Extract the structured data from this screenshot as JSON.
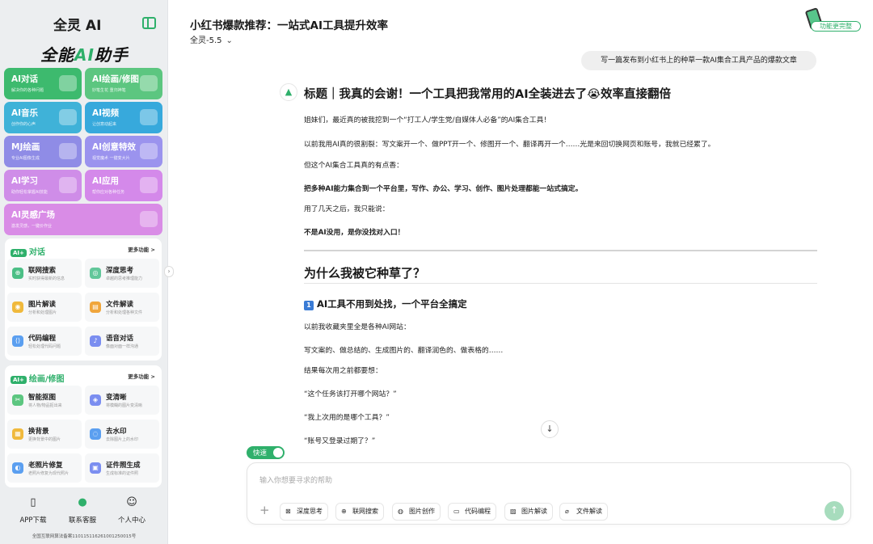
{
  "sidebar": {
    "brand": "全灵 AI",
    "slogan_pre": "全能",
    "slogan_ai": "AI",
    "slogan_post": "助手",
    "cards": [
      {
        "title": "AI对话",
        "sub": "解决你的各种问题",
        "color": "#3dba6e"
      },
      {
        "title": "AI绘画/修图",
        "sub": "妙笔生花 重归神笔",
        "color": "#5cc680"
      },
      {
        "title": "AI音乐",
        "sub": "创作你的心声",
        "color": "#3fb2d8"
      },
      {
        "title": "AI视频",
        "sub": "让创意动起来",
        "color": "#37a9dc"
      },
      {
        "title": "MJ绘画",
        "sub": "专业AI图像生成",
        "color": "#8f8ce6"
      },
      {
        "title": "AI创意特效",
        "sub": "视觉魔术 一键变大片",
        "color": "#9b93ee"
      },
      {
        "title": "AI学习",
        "sub": "助你轻松掌握AI技能",
        "color": "#cf8de8"
      },
      {
        "title": "AI应用",
        "sub": "帮你应对各种任务",
        "color": "#d489ea"
      },
      {
        "title": "AI灵感广场",
        "sub": "激发灵感，一键价作业",
        "color": "#d98ce6"
      }
    ],
    "chat_panel": {
      "tag": "AI+",
      "heading": "对话",
      "more": "更多功能 >",
      "items": [
        {
          "title": "联网搜索",
          "sub": "实时获得最新的信息",
          "color": "#4cbf86",
          "glyph": "⊕"
        },
        {
          "title": "深度思考",
          "sub": "卓越的思考推理能力",
          "color": "#62c79a",
          "glyph": "◎"
        },
        {
          "title": "图片解读",
          "sub": "分析和处理图片",
          "color": "#f0b93c",
          "glyph": "◉"
        },
        {
          "title": "文件解读",
          "sub": "分析和处理各种文件",
          "color": "#f0a63c",
          "glyph": "▤"
        },
        {
          "title": "代码编程",
          "sub": "轻松处理代码问题",
          "color": "#5b9ff0",
          "glyph": "⟨⟩"
        },
        {
          "title": "语音对话",
          "sub": "像面对面一样沟通",
          "color": "#7b8ef0",
          "glyph": "♪"
        }
      ]
    },
    "draw_panel": {
      "tag": "AI+",
      "heading": "绘画/修图",
      "more": "更多功能 >",
      "items": [
        {
          "title": "智能抠图",
          "sub": "将人物/物品抠出来",
          "color": "#5cc680",
          "glyph": "✂"
        },
        {
          "title": "变清晰",
          "sub": "将模糊的图片变清晰",
          "color": "#7b8ef0",
          "glyph": "◈"
        },
        {
          "title": "换背景",
          "sub": "更换背景中的图片",
          "color": "#f0b93c",
          "glyph": "▦"
        },
        {
          "title": "去水印",
          "sub": "去除图片上的水印",
          "color": "#5b9ff0",
          "glyph": "◌"
        },
        {
          "title": "老照片修复",
          "sub": "老照片修复为现代照片",
          "color": "#5b9ff0",
          "glyph": "◐"
        },
        {
          "title": "证件照生成",
          "sub": "生成标准的证件照",
          "color": "#7b8ef0",
          "glyph": "▣"
        }
      ]
    },
    "footer": [
      {
        "label": "APP下载",
        "icon": "phone-icon",
        "glyph": "▯"
      },
      {
        "label": "联系客服",
        "icon": "support-avatar-icon",
        "glyph": "●"
      },
      {
        "label": "个人中心",
        "icon": "user-icon",
        "glyph": "☺"
      }
    ],
    "icp": "全国互联网算法备案110115116261001250015号"
  },
  "header": {
    "title": "小红书爆款推荐：一站式AI工具提升效率",
    "model": "全灵-5.5",
    "upgrade": "功能更完整"
  },
  "chat": {
    "user_message": "写一篇发布到小红书上的种草一款AI集合工具产品的爆款文章",
    "h1": "标题｜我真的会谢！一个工具把我常用的AI全装进去了😭效率直接翻倍",
    "p1": "姐妹们，最近真的被我挖到一个“打工人/学生党/自媒体人必备”的AI集合工具！",
    "p2": "以前我用AI真的很割裂：写文案开一个、做PPT开一个、修图开一个、翻译再开一个……光是来回切换网页和账号，我就已经累了。",
    "p3": "但这个AI集合工具真的有点香：",
    "p4": "把多种AI能力集合到一个平台里，写作、办公、学习、创作、图片处理都能一站式搞定。",
    "p5": "用了几天之后，我只能说：",
    "p6": "不是AI没用，是你没找对入口！",
    "h2": "为什么我被它种草了？",
    "h3_num": "1",
    "h3": "AI工具不用到处找，一个平台全搞定",
    "p7": "以前我收藏夹里全是各种AI网站：",
    "p8": "写文案的、做总结的、生成图片的、翻译润色的、做表格的……",
    "p9": "结果每次用之前都要想：",
    "p10": "“这个任务该打开哪个网站？”",
    "p11": "“我上次用的是哪个工具？”",
    "p12": "“账号又登录过期了？”"
  },
  "composer": {
    "quick_label": "快速",
    "placeholder": "输入你想要寻求的帮助",
    "tools": [
      {
        "label": "深度思考",
        "icon": "deep-think-icon",
        "glyph": "⊠"
      },
      {
        "label": "联网搜索",
        "icon": "globe-icon",
        "glyph": "⊕"
      },
      {
        "label": "图片创作",
        "icon": "palette-icon",
        "glyph": "◍"
      },
      {
        "label": "代码编程",
        "icon": "code-icon",
        "glyph": "▭"
      },
      {
        "label": "图片解读",
        "icon": "image-icon",
        "glyph": "▨"
      },
      {
        "label": "文件解读",
        "icon": "paperclip-icon",
        "glyph": "⌀"
      }
    ]
  },
  "colors": {
    "accent": "#2fb06b",
    "send_disabled": "#a7dcbd"
  }
}
